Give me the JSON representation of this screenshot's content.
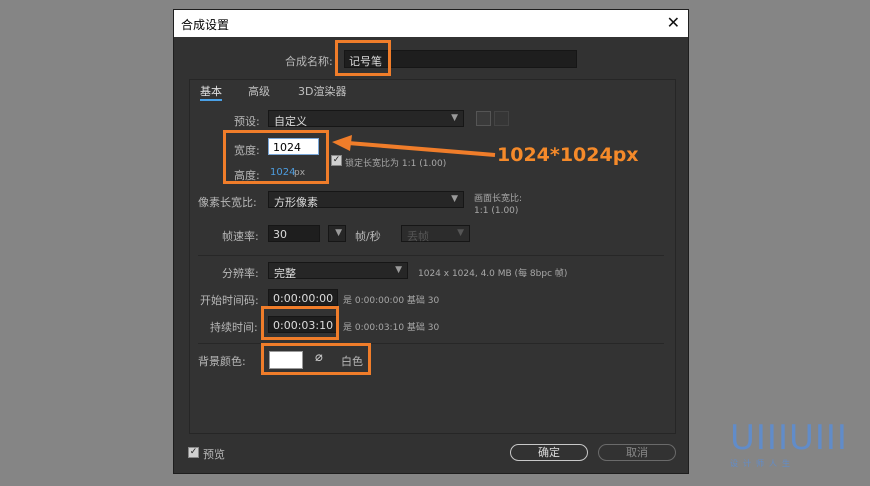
{
  "dialog": {
    "title": "合成设置",
    "close_glyph": "✕",
    "comp_name_label": "合成名称:",
    "comp_name_value": "记号笔",
    "tabs": [
      {
        "label": "基本",
        "active": true
      },
      {
        "label": "高级",
        "active": false
      },
      {
        "label": "3D渲染器",
        "active": false
      }
    ],
    "preset_label": "预设:",
    "preset_value": "自定义",
    "width_label": "宽度:",
    "width_value": "1024",
    "height_label": "高度:",
    "height_value": "1024",
    "height_unit": "px",
    "lock_aspect_label": "锁定长宽比为 1:1 (1.00)",
    "pixel_aspect_label": "像素长宽比:",
    "pixel_aspect_value": "方形像素",
    "frame_aspect_label": "画面长宽比:",
    "frame_aspect_value": "1:1 (1.00)",
    "frame_rate_label": "帧速率:",
    "frame_rate_value": "30",
    "frame_rate_unit": "帧/秒",
    "drop_frame_value": "丢帧",
    "resolution_label": "分辨率:",
    "resolution_value": "完整",
    "resolution_info": "1024 x 1024, 4.0 MB (每 8bpc 帧)",
    "start_timecode_label": "开始时间码:",
    "start_timecode_value": "0:00:00:00",
    "start_timecode_info": "是 0:00:00:00  基础 30",
    "duration_label": "持续时间:",
    "duration_value": "0:00:03:10",
    "duration_info": "是 0:00:03:10  基础 30",
    "bg_color_label": "背景颜色:",
    "bg_color_name": "白色",
    "bg_color_hex": "#ffffff",
    "preview_label": "预览",
    "ok_label": "确定",
    "cancel_label": "取消"
  },
  "annotation": {
    "text": "1024*1024px",
    "color": "#f07d2a"
  },
  "watermark": {
    "main": "UIIIUIII",
    "sub": "设计师人生"
  }
}
